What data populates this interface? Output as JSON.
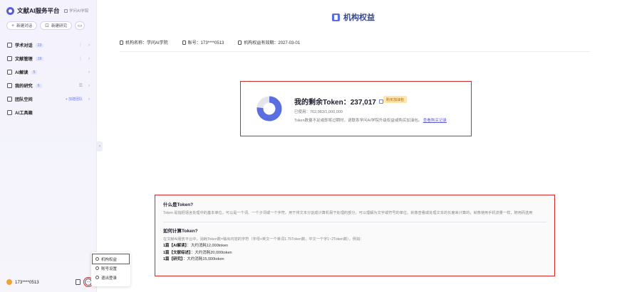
{
  "sidebar": {
    "brand_name": "文献AI服务平台",
    "brand_sub": "学问AI学院",
    "new_chat": "新建对话",
    "new_research": "新建研究",
    "items": [
      {
        "label": "学术对话",
        "badge": "23"
      },
      {
        "label": "文献管理",
        "badge": "19"
      },
      {
        "label": "AI解读",
        "badge": "5"
      },
      {
        "label": "我的研究",
        "badge": "6"
      },
      {
        "label": "团队空间",
        "badge": "",
        "action": "+ 加建团队"
      },
      {
        "label": "AI工具箱",
        "badge": ""
      }
    ],
    "user_name": "173****0513",
    "popup": [
      "机构权益",
      "账号设置",
      "退出登录"
    ]
  },
  "main": {
    "page_title": "机构权益",
    "info": {
      "org_label": "机构名称：学问AI学院",
      "account_label": "账号：173****0513",
      "expiry_label": "机构权益有效期：2027-03-01"
    },
    "token": {
      "title": "我的剩余Token：237,017",
      "buy_tag": "购买加油包",
      "used": "已使用：762,983/1,000,000",
      "tip": "Token数量不足或即将过期时，请联系学问AI学院升级权益或购买加油包。",
      "tip_link": "查看购买记录",
      "used_value": 762983,
      "total_value": 1000000
    },
    "faq": {
      "q1": "什么是Token?",
      "a1": "Token 是指把语言处理中的基本单位，可以是一个词、一个子词或一个字符。用于将文本分割成计算机易于处理的部分，可以理解为文字或符号的单位。就像查看或处理文本的长度来计算的，就像使用手机流量一样，随用而选用",
      "q2": "如何计算Token?",
      "a2": "在文献AI服务平台中，消耗Token数=输出内容的字符（字母+英文一个单词1.75Token数，中文一个字1~2Token数），例如：",
      "examples": [
        {
          "prefix": "1篇【AI解读】",
          "suffix": "：大约消耗12,000token"
        },
        {
          "prefix": "1篇【文献综述】",
          "suffix": "：大约消耗20,000token"
        },
        {
          "prefix": "1篇【研究】",
          "suffix": "：大约消耗15,000token"
        }
      ]
    }
  },
  "colors": {
    "accent": "#5b5bd6",
    "donut_used": "#5b6ee0",
    "donut_rest": "#e4e4ec",
    "highlight": "#d62828"
  }
}
